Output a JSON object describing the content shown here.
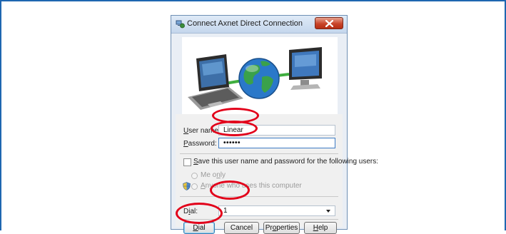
{
  "dialog": {
    "title": "Connect Axnet Direct Connection",
    "user_name_label": "User name:",
    "user_name_value": "Linear",
    "password_label": "Password:",
    "password_value": "••••••",
    "save_label": "Save this user name and password for the following users:",
    "me_only_label": "Me only",
    "anyone_label": "Anyone who uses this computer",
    "dial_label": "Dial:",
    "dial_value": "1",
    "buttons": {
      "dial": "Dial",
      "cancel": "Cancel",
      "properties": "Properties",
      "help": "Help"
    }
  },
  "colors": {
    "frame_border": "#1e66b0",
    "callout": "#e2001a"
  },
  "icons": [
    "network-connection-icon",
    "close-icon",
    "laptop-icon",
    "globe-icon",
    "monitor-icon",
    "uac-shield-icon",
    "dropdown-arrow-icon"
  ]
}
